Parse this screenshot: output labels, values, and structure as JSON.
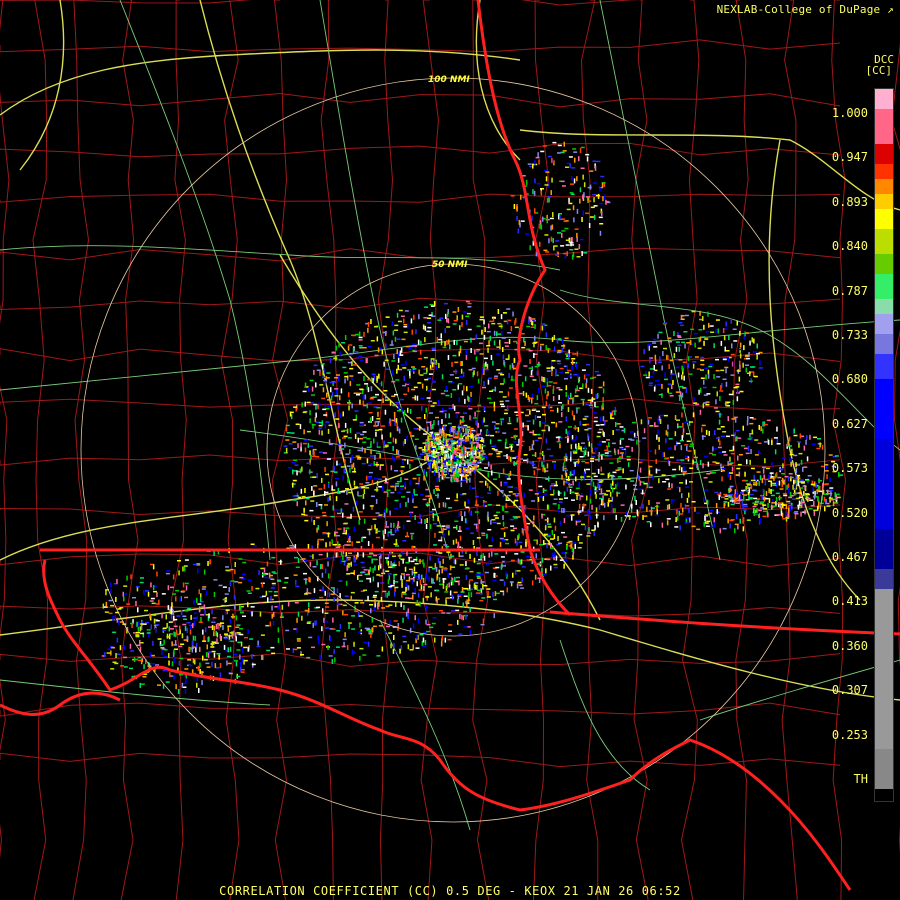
{
  "header": {
    "credit": "NEXLAB-College of DuPage",
    "product_code": "DCC",
    "unit_label": "[CC]"
  },
  "footer": {
    "caption": "CORRELATION COEFFICIENT (CC) 0.5 DEG - KEOX 21 JAN 26 06:52"
  },
  "rings": [
    {
      "label": "100 NMI"
    },
    {
      "label": "50 NMI"
    }
  ],
  "legend": {
    "ticks": [
      "1.000",
      "0.947",
      "0.893",
      "0.840",
      "0.787",
      "0.733",
      "0.680",
      "0.627",
      "0.573",
      "0.520",
      "0.467",
      "0.413",
      "0.360",
      "0.307",
      "0.253",
      "TH"
    ]
  },
  "colors": {
    "state_border": "#ff2020",
    "county_border": "#a01818",
    "highway": "#dddd55",
    "road": "#77cc77",
    "ring": "#e8c8a0",
    "text": "#ffff66"
  }
}
